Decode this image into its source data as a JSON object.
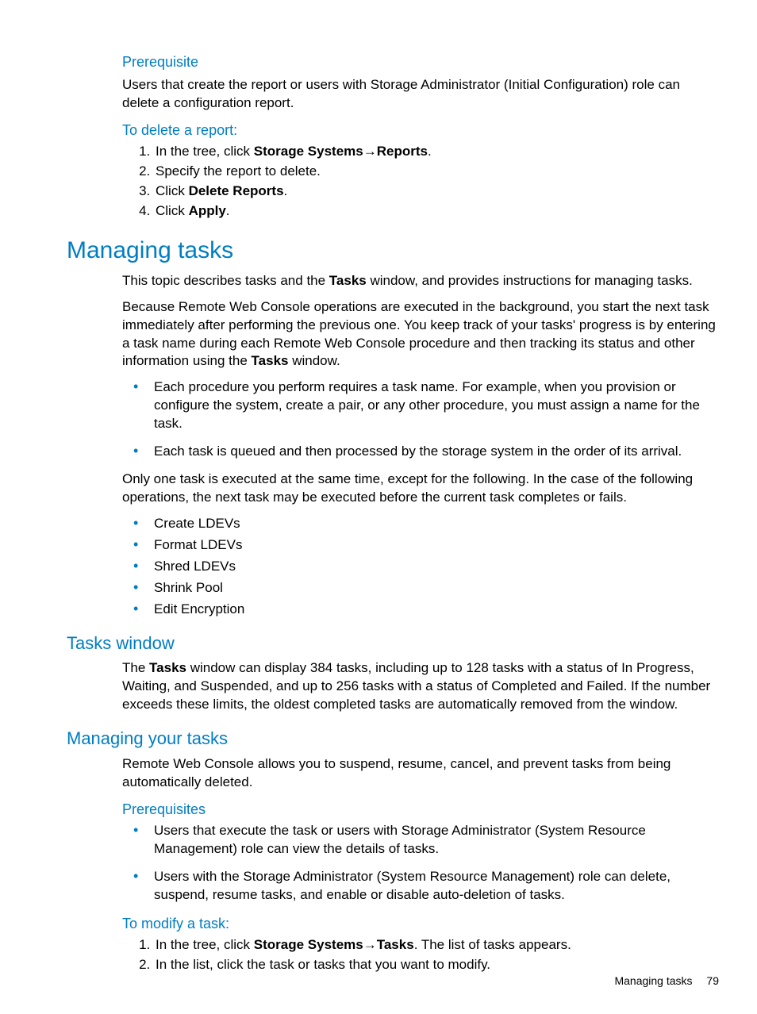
{
  "prereq1": {
    "heading": "Prerequisite",
    "text": "Users that create the report or users with Storage Administrator (Initial Configuration) role can delete a configuration report."
  },
  "delete_report": {
    "heading": "To delete a report:",
    "steps": {
      "s1_pre": "In the tree, click ",
      "s1_b1": "Storage Systems",
      "s1_arrow": "→",
      "s1_b2": "Reports",
      "s1_post": ".",
      "s2": "Specify the report to delete.",
      "s3_pre": "Click ",
      "s3_b": "Delete Reports",
      "s3_post": ".",
      "s4_pre": "Click ",
      "s4_b": "Apply",
      "s4_post": "."
    }
  },
  "managing_tasks": {
    "heading": "Managing tasks",
    "p1_pre": "This topic describes tasks and the ",
    "p1_b": "Tasks",
    "p1_post": " window, and provides instructions for managing tasks.",
    "p2_pre": "Because Remote Web Console operations are executed in the background, you start the next task immediately after performing the previous one. You keep track of your tasks' progress is by entering a task name during each Remote Web Console procedure and then tracking its status and other information using the ",
    "p2_b": "Tasks",
    "p2_post": " window.",
    "bullets1": {
      "b1": "Each procedure you perform requires a task name. For example, when you provision or configure the system, create a pair, or any other procedure, you must assign a name for the task.",
      "b2": "Each task is queued and then processed by the storage system in the order of its arrival."
    },
    "p3": "Only one task is executed at the same time, except for the following. In the case of the following operations, the next task may be executed before the current task completes or fails.",
    "ops": {
      "o1": "Create LDEVs",
      "o2": "Format LDEVs",
      "o3": "Shred LDEVs",
      "o4": "Shrink Pool",
      "o5": "Edit Encryption"
    }
  },
  "tasks_window": {
    "heading": "Tasks window",
    "p_pre": "The ",
    "p_b": "Tasks",
    "p_post": " window can display 384 tasks, including up to 128 tasks with a status of In Progress, Waiting, and Suspended, and up to 256 tasks with a status of Completed and Failed. If the number exceeds these limits, the oldest completed tasks are automatically removed from the window."
  },
  "managing_your_tasks": {
    "heading": "Managing your tasks",
    "p1": "Remote Web Console allows you to suspend, resume, cancel, and prevent tasks from being automatically deleted.",
    "prereq_heading": "Prerequisites",
    "prereq_bullets": {
      "b1": "Users that execute the task or users with Storage Administrator (System Resource Management) role can view the details of tasks.",
      "b2": "Users with the Storage Administrator (System Resource Management) role can delete, suspend, resume tasks, and enable or disable auto-deletion of tasks."
    },
    "modify_heading": "To modify a task:",
    "modify_steps": {
      "s1_pre": "In the tree, click ",
      "s1_b1": "Storage Systems",
      "s1_arrow": "→",
      "s1_b2": "Tasks",
      "s1_post": ". The list of tasks appears.",
      "s2": "In the list, click the task or tasks that you want to modify."
    }
  },
  "footer": {
    "label": "Managing tasks",
    "page": "79"
  }
}
